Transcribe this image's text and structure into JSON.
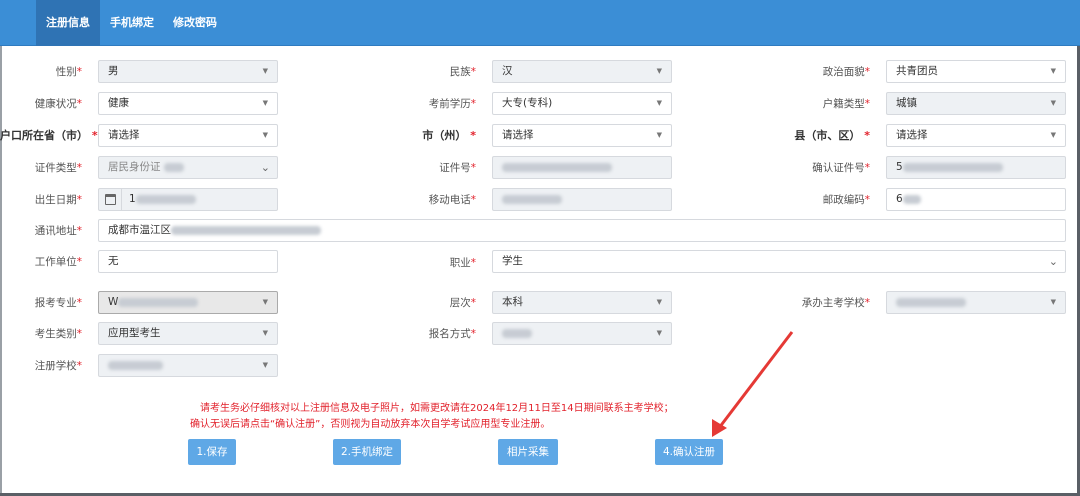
{
  "tabs": [
    {
      "label": "注册信息",
      "active": true
    },
    {
      "label": "手机绑定",
      "active": false
    },
    {
      "label": "修改密码",
      "active": false
    }
  ],
  "form": {
    "gender": {
      "label": "性别",
      "value": "男"
    },
    "ethnicity": {
      "label": "民族",
      "value": "汉"
    },
    "political": {
      "label": "政治面貌",
      "value": "共青团员"
    },
    "health": {
      "label": "健康状况",
      "value": "健康"
    },
    "education": {
      "label": "考前学历",
      "value": "大专(专科)"
    },
    "hukou_type": {
      "label": "户籍类型",
      "value": "城镇"
    },
    "hukou_province": {
      "label": "户口所在省（市）",
      "label_visible": "户口所在省（市）",
      "value": "请选择"
    },
    "city": {
      "label": "市（州）",
      "value": "请选择"
    },
    "county": {
      "label": "县（市、区）",
      "value": "请选择"
    },
    "id_type": {
      "label": "证件类型",
      "value": "居民身份证"
    },
    "id_number": {
      "label": "证件号",
      "value": ""
    },
    "id_confirm": {
      "label": "确认证件号",
      "value": "5"
    },
    "birth_date": {
      "label": "出生日期",
      "value": "1"
    },
    "mobile": {
      "label": "移动电话",
      "value": ""
    },
    "postal_code": {
      "label": "邮政编码",
      "value": "6"
    },
    "address": {
      "label": "通讯地址",
      "value": "成都市温江区"
    },
    "work_unit": {
      "label": "工作单位",
      "value": "无"
    },
    "occupation": {
      "label": "职业",
      "value": "学生"
    },
    "major": {
      "label": "报考专业",
      "value": "W"
    },
    "level": {
      "label": "层次",
      "value": "本科"
    },
    "host_school": {
      "label": "承办主考学校",
      "value": ""
    },
    "candidate_type": {
      "label": "考生类别",
      "value": "应用型考生"
    },
    "apply_method": {
      "label": "报名方式",
      "value": ""
    },
    "reg_school": {
      "label": "注册学校",
      "value": ""
    }
  },
  "notice": {
    "line1": "请考生务必仔细核对以上注册信息及电子照片，如需更改请在2024年12月11日至14日期间联系主考学校；",
    "line2": "确认无误后请点击“确认注册”，否则视为自动放弃本次自学考试应用型专业注册。"
  },
  "buttons": {
    "save": "1.保存",
    "phone_bind": "2.手机绑定",
    "photo": "相片采集",
    "confirm": "4.确认注册"
  },
  "colors": {
    "header": "#3b8ed6",
    "button": "#5fa8e6",
    "required": "#e2222c",
    "annotation_arrow": "#e53935"
  },
  "icons": [
    "dropdown-arrow-icon",
    "chevron-down-icon",
    "calendar-icon",
    "annotation-arrow"
  ]
}
